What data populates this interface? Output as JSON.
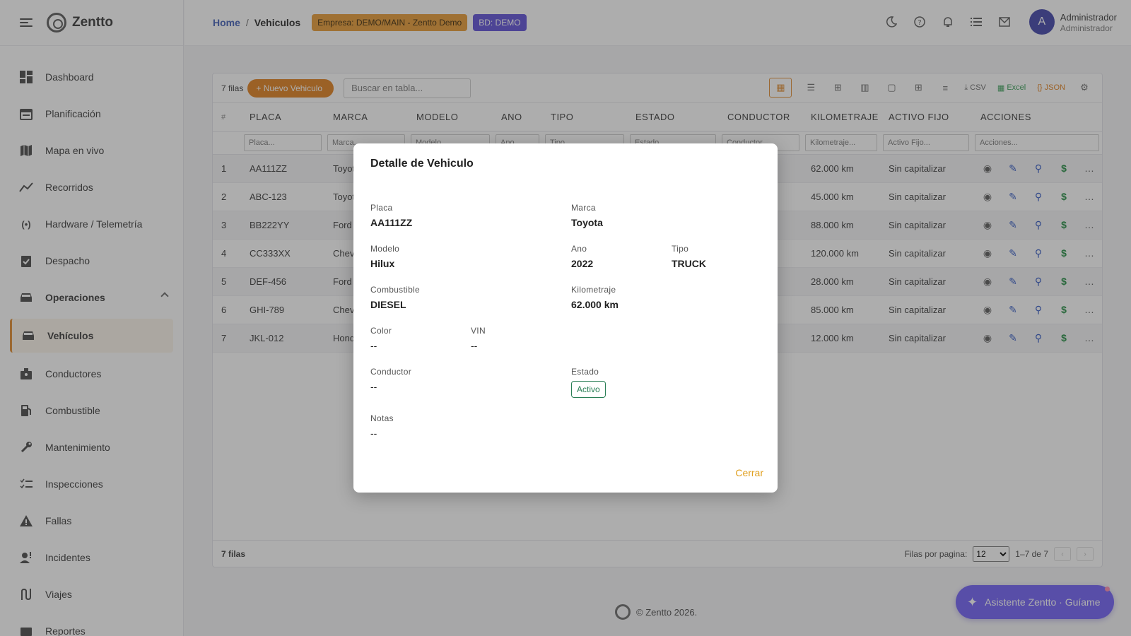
{
  "app": {
    "brand": "Zentto"
  },
  "sidebar": {
    "items": [
      {
        "label": "Dashboard",
        "icon": "dashboard-icon"
      },
      {
        "label": "Planificación",
        "icon": "calendar-icon"
      },
      {
        "label": "Mapa en vivo",
        "icon": "map-icon"
      },
      {
        "label": "Recorridos",
        "icon": "timeline-icon"
      },
      {
        "label": "Hardware / Telemetría",
        "icon": "signal-icon"
      },
      {
        "label": "Despacho",
        "icon": "clipboard-check-icon"
      },
      {
        "label": "Operaciones",
        "icon": "car-icon"
      },
      {
        "label": "Vehículos",
        "icon": "car-icon"
      },
      {
        "label": "Conductores",
        "icon": "badge-icon"
      },
      {
        "label": "Combustible",
        "icon": "fuel-icon"
      },
      {
        "label": "Mantenimiento",
        "icon": "wrench-icon"
      },
      {
        "label": "Inspecciones",
        "icon": "checklist-icon"
      },
      {
        "label": "Fallas",
        "icon": "warning-icon"
      },
      {
        "label": "Incidentes",
        "icon": "incident-icon"
      },
      {
        "label": "Viajes",
        "icon": "route-icon"
      },
      {
        "label": "Reportes",
        "icon": "report-icon"
      }
    ]
  },
  "topbar": {
    "home": "Home",
    "sep": "/",
    "current": "Vehiculos",
    "company_chip": "Empresa: DEMO/MAIN - Zentto Demo",
    "db_chip": "BD: DEMO",
    "user_initial": "A",
    "user_name": "Administrador",
    "user_role": "Administrador"
  },
  "table": {
    "rows_count": "7 filas",
    "new_button": "Nuevo Vehiculo",
    "search_placeholder": "Buscar en tabla...",
    "csv_label": "CSV",
    "excel_label": "Excel",
    "json_label": "JSON",
    "columns": [
      "#",
      "PLACA",
      "MARCA",
      "MODELO",
      "ANO",
      "TIPO",
      "ESTADO",
      "CONDUCTOR",
      "KILOMETRAJE",
      "ACTIVO FIJO",
      "ACCIONES"
    ],
    "filters": [
      "Placa...",
      "Marca...",
      "Modelo...",
      "Ano...",
      "Tipo...",
      "Estado...",
      "Conductor...",
      "Kilometraje...",
      "Activo Fijo...",
      "Acciones..."
    ],
    "rows": [
      {
        "n": "1",
        "placa": "AA111ZZ",
        "marca": "Toyota",
        "km": "62.000 km",
        "activo": "Sin capitalizar"
      },
      {
        "n": "2",
        "placa": "ABC-123",
        "marca": "Toyota",
        "km": "45.000 km",
        "activo": "Sin capitalizar"
      },
      {
        "n": "3",
        "placa": "BB222YY",
        "marca": "Ford",
        "km": "88.000 km",
        "activo": "Sin capitalizar"
      },
      {
        "n": "4",
        "placa": "CC333XX",
        "marca": "Chevrolet",
        "km": "120.000 km",
        "activo": "Sin capitalizar"
      },
      {
        "n": "5",
        "placa": "DEF-456",
        "marca": "Ford",
        "km": "28.000 km",
        "activo": "Sin capitalizar"
      },
      {
        "n": "6",
        "placa": "GHI-789",
        "marca": "Chevrolet",
        "km": "85.000 km",
        "activo": "Sin capitalizar"
      },
      {
        "n": "7",
        "placa": "JKL-012",
        "marca": "Honda",
        "km": "12.000 km",
        "activo": "Sin capitalizar"
      }
    ],
    "footer_count": "7 filas",
    "rows_per_page_label": "Filas por pagina:",
    "rows_per_page": "12",
    "range": "1–7 de 7"
  },
  "footer": {
    "copyright": "© Zentto 2026."
  },
  "assistant": {
    "label": "Asistente Zentto · Guíame"
  },
  "modal": {
    "title": "Detalle de Vehiculo",
    "fields": {
      "placa": {
        "label": "Placa",
        "value": "AA111ZZ"
      },
      "marca": {
        "label": "Marca",
        "value": "Toyota"
      },
      "modelo": {
        "label": "Modelo",
        "value": "Hilux"
      },
      "ano": {
        "label": "Ano",
        "value": "2022"
      },
      "tipo": {
        "label": "Tipo",
        "value": "TRUCK"
      },
      "combustible": {
        "label": "Combustible",
        "value": "DIESEL"
      },
      "kilometraje": {
        "label": "Kilometraje",
        "value": "62.000 km"
      },
      "color": {
        "label": "Color",
        "value": "--"
      },
      "vin": {
        "label": "VIN",
        "value": "--"
      },
      "conductor": {
        "label": "Conductor",
        "value": "--"
      },
      "estado": {
        "label": "Estado",
        "value": "Activo"
      },
      "notas": {
        "label": "Notas",
        "value": "--"
      }
    },
    "close_label": "Cerrar"
  },
  "colors": {
    "accent": "#e07c17",
    "db_chip": "#5a4bd6",
    "assistant": "#6d5cf6",
    "status_active": "#2a7f56"
  }
}
